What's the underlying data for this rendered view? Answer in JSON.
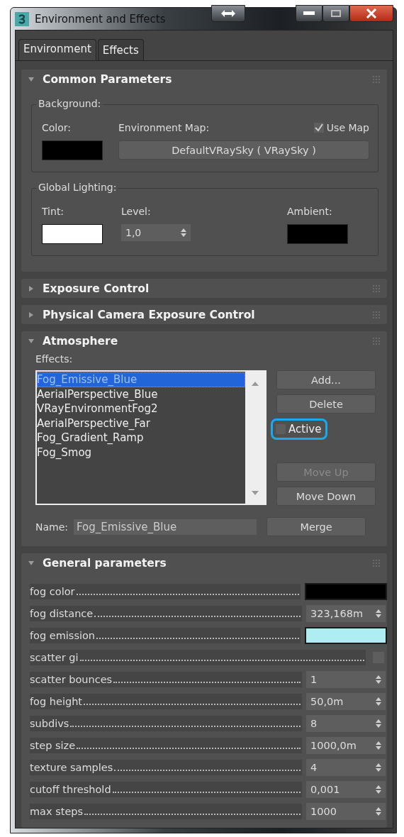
{
  "window": {
    "title": "Environment and Effects"
  },
  "tabs": [
    {
      "label": "Environment",
      "selected": true
    },
    {
      "label": "Effects",
      "selected": false
    }
  ],
  "common_parameters": {
    "title": "Common Parameters",
    "expanded": true,
    "background": {
      "group_label": "Background:",
      "color_label": "Color:",
      "color": "#000000",
      "map_label": "Environment Map:",
      "use_map": {
        "label": "Use Map",
        "checked": true
      },
      "map_button": "DefaultVRaySky ( VRaySky )"
    },
    "global_lighting": {
      "group_label": "Global Lighting:",
      "tint": {
        "label": "Tint:",
        "color": "#ffffff"
      },
      "level_label": "Level:",
      "level_value": "1,0",
      "ambient": {
        "label": "Ambient:",
        "color": "#000000"
      }
    }
  },
  "collapsed_rollouts": [
    {
      "title": "Exposure Control",
      "expanded": false
    },
    {
      "title": "Physical Camera Exposure Control",
      "expanded": false
    }
  ],
  "atmosphere": {
    "title": "Atmosphere",
    "expanded": true,
    "effects_label": "Effects:",
    "effects": [
      {
        "name": "Fog_Emissive_Blue",
        "selected": true
      },
      {
        "name": "AerialPerspective_Blue",
        "selected": false
      },
      {
        "name": "VRayEnvironmentFog2",
        "selected": false
      },
      {
        "name": "AerialPerspective_Far",
        "selected": false
      },
      {
        "name": "Fog_Gradient_Ramp",
        "selected": false
      },
      {
        "name": "Fog_Smog",
        "selected": false
      }
    ],
    "buttons_top": [
      {
        "label": "Add...",
        "disabled": false
      },
      {
        "label": "Delete",
        "disabled": false
      }
    ],
    "active": {
      "label": "Active",
      "checked": false,
      "focused": true
    },
    "buttons_bottom": [
      {
        "label": "Move Up",
        "disabled": true
      },
      {
        "label": "Move Down",
        "disabled": false
      }
    ],
    "name_label": "Name:",
    "name_value": "Fog_Emissive_Blue",
    "merge_button": "Merge"
  },
  "general_parameters": {
    "title": "General parameters",
    "expanded": true,
    "params": [
      {
        "label": "fog color",
        "kind": "color",
        "color": "#000000"
      },
      {
        "label": "fog distance",
        "kind": "spinner",
        "value": "323,168m"
      },
      {
        "label": "fog emission",
        "kind": "color",
        "color": "#aeeef2"
      },
      {
        "label": "scatter gi",
        "kind": "checkbox",
        "checked": false
      },
      {
        "label": "scatter bounces",
        "kind": "spinner",
        "value": "1"
      },
      {
        "label": "fog height",
        "kind": "spinner",
        "value": "50,0m"
      },
      {
        "label": "subdivs",
        "kind": "spinner",
        "value": "8"
      },
      {
        "label": "step size",
        "kind": "spinner",
        "value": "1000,0m"
      },
      {
        "label": "texture samples",
        "kind": "spinner",
        "value": "4"
      },
      {
        "label": "cutoff threshold",
        "kind": "spinner",
        "value": "0,001"
      },
      {
        "label": "max steps",
        "kind": "spinner",
        "value": "1000"
      }
    ]
  }
}
